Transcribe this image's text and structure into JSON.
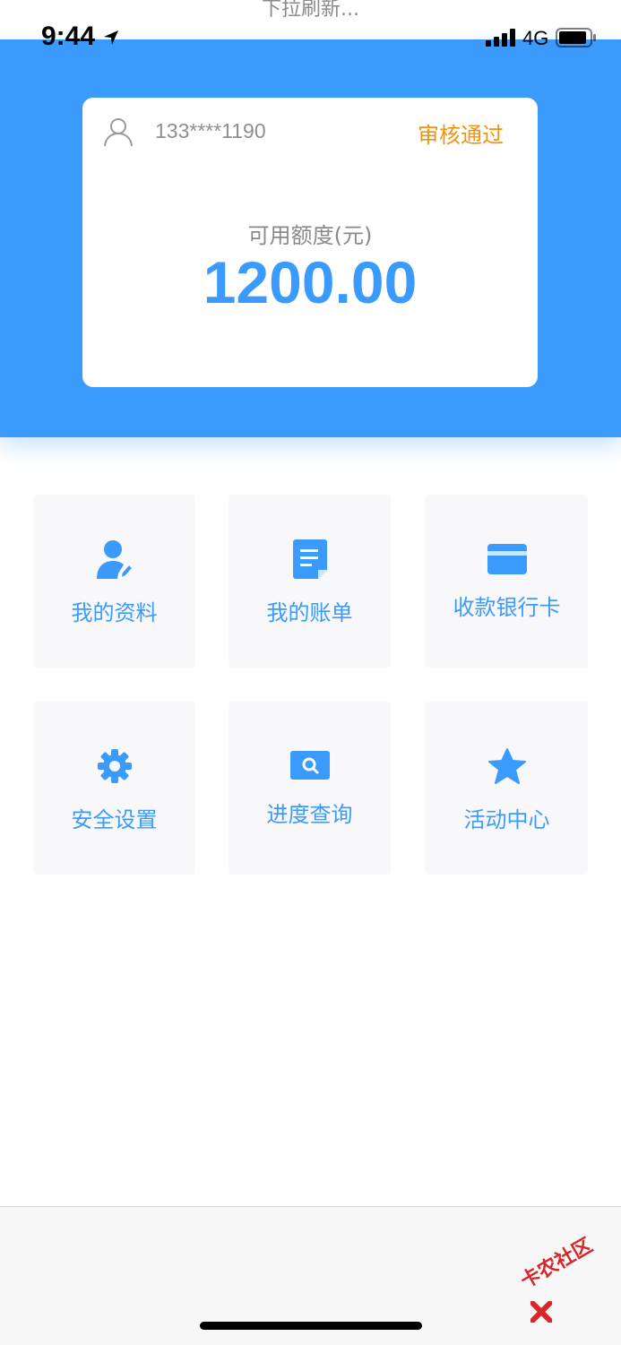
{
  "pull_hint": "下拉刷新...",
  "status_bar": {
    "time": "9:44",
    "network": "4G"
  },
  "card": {
    "phone": "133****1190",
    "status": "审核通过",
    "credit_label": "可用额度(元)",
    "credit_amount": "1200.00"
  },
  "menu": [
    {
      "label": "我的资料",
      "icon": "user-edit-icon"
    },
    {
      "label": "我的账单",
      "icon": "bill-document-icon"
    },
    {
      "label": "收款银行卡",
      "icon": "bank-card-icon"
    },
    {
      "label": "安全设置",
      "icon": "gear-icon"
    },
    {
      "label": "进度查询",
      "icon": "search-icon"
    },
    {
      "label": "活动中心",
      "icon": "star-icon"
    }
  ],
  "watermark": "卡农社区",
  "colors": {
    "primary": "#3a9bfd",
    "status": "#f3920b",
    "tile_bg": "#f8f8fa"
  }
}
